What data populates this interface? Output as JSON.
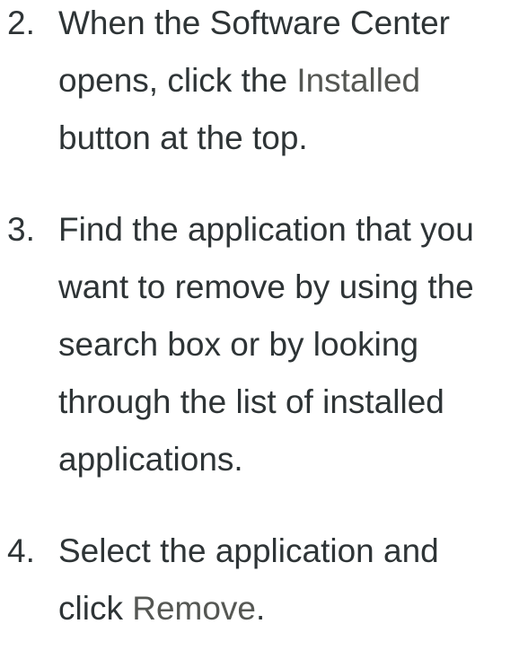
{
  "steps": [
    {
      "number": "2.",
      "text_before": "When the Software Center opens, click the ",
      "gui_label": "Installed",
      "text_after": " button at the top."
    },
    {
      "number": "3.",
      "text": "Find the application that you want to remove by using the search box or by looking through the list of installed applications."
    },
    {
      "number": "4.",
      "text_before": "Select the application and click ",
      "gui_label": "Remove",
      "text_after": "."
    }
  ]
}
